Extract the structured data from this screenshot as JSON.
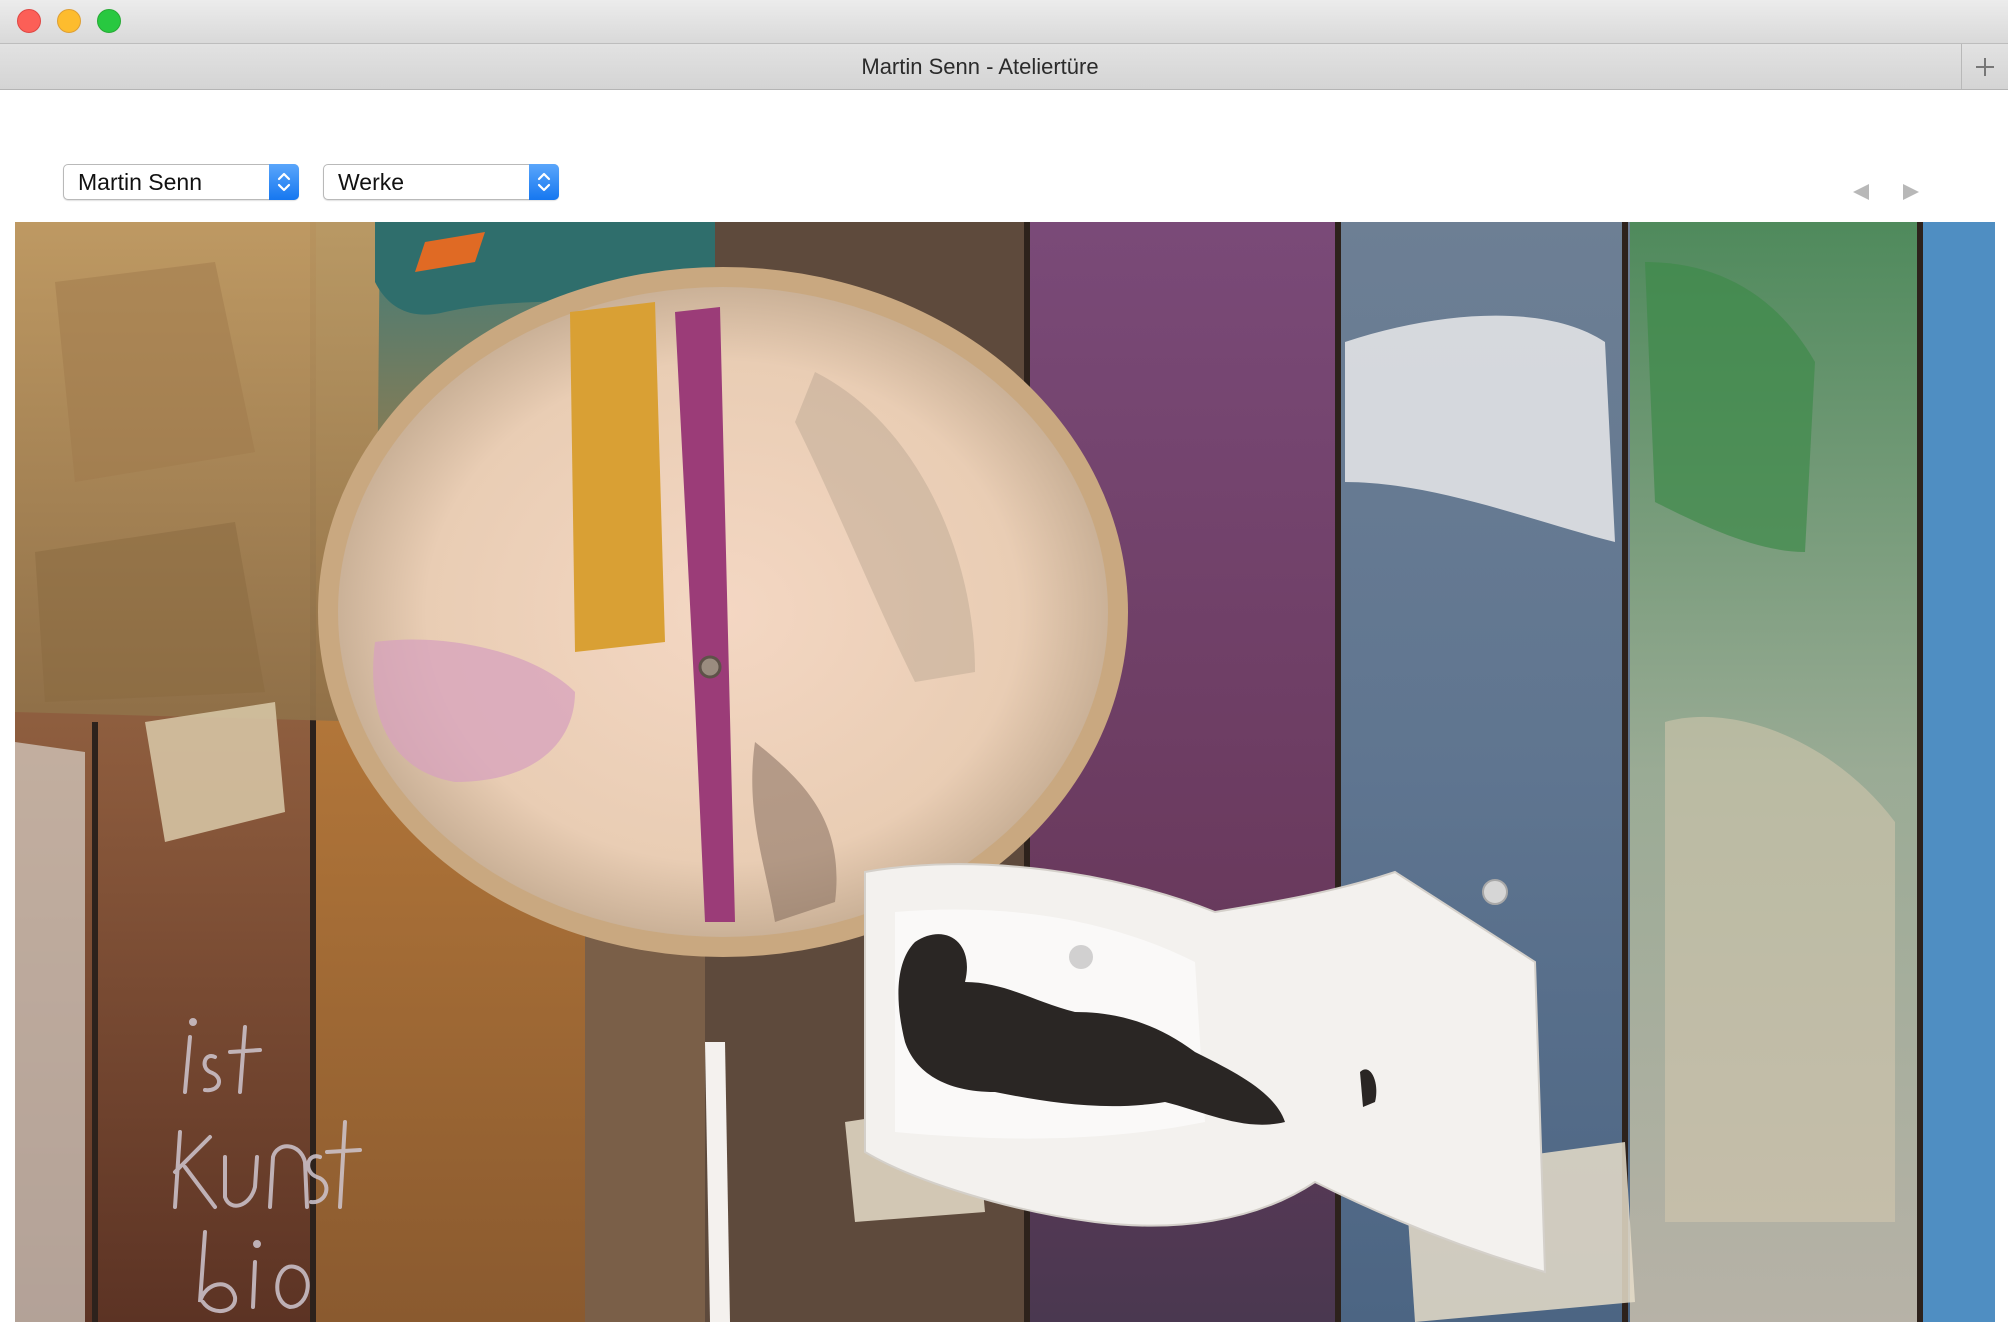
{
  "window": {
    "tab_title": "Martin Senn - Ateliertüre"
  },
  "controls": {
    "artist_select": {
      "selected": "Martin Senn"
    },
    "section_select": {
      "selected": "Werke"
    }
  },
  "artwork": {
    "scribble_lines": [
      "ist",
      "kunst",
      "bio"
    ]
  },
  "colors": {
    "stepper_blue": "#1677f0",
    "nav_arrow": "#b8b8b8"
  },
  "icons": {
    "prev": "triangle-left-icon",
    "next": "triangle-right-icon",
    "add_tab": "plus-icon"
  }
}
